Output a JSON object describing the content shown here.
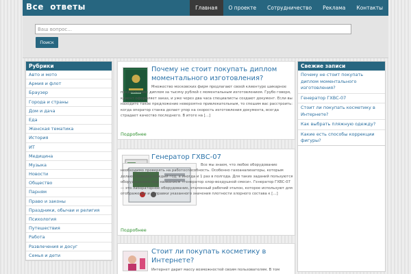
{
  "site": {
    "logo_text": "Все  ответы"
  },
  "nav": {
    "items": [
      "Главная",
      "О проекте",
      "Сотрудничество",
      "Реклама",
      "Контакты"
    ]
  },
  "search": {
    "placeholder": "Ваш вопрос...",
    "button_label": "Поиск"
  },
  "left_sidebar": {
    "title": "Рубрики",
    "items": [
      "Авто и мото",
      "Армия и флот",
      "Браузер",
      "Города и страны",
      "Дом и дача",
      "Еда",
      "Женская тематика",
      "История",
      "ИТ",
      "Медицина",
      "Музыка",
      "Новости",
      "Общество",
      "Парням",
      "Право и законы",
      "Праздники, обычаи и религия",
      "Психология",
      "Путешествия",
      "Работа",
      "Развлечения и досуг",
      "Семья и дети"
    ]
  },
  "posts": [
    {
      "title": "Почему не стоит покупать диплом моментального изготовления?",
      "excerpt": "Множество московских фирм предлагают своей клиентуре шикарное предложение: диплом за тысячу рублей с моментальным изготовлением. Грубо говоря, клиент оформляет заказ, и уже через два часа специалисты создают документ. Если вы находите такое предложение невероятно привлекательным, то спешим вас расстроить: когда оператор станка делает упор на скорость изготовления документа, всегда страдает качество последнего. В итоге на […]",
      "more": "Подробнее",
      "thumb": "diploma-image"
    },
    {
      "title": "Генератор ГХВС-07",
      "excerpt": "Все мы знаем, что любое оборудование необходимо проверять на работоспособность. Особенно газоанализаторы, которым делают поверку каждый год, а иногда и 1 раз в полгода. Для таких заданий пользуются оборудованием под названием «генератор хлор-воздушной смеси». Генератор ГХВС-07 — это лабораторное оборудование, эталонный рабочий эталон, которое используют для отображения и отправки указанного значения плотности хлорного состава к […]",
      "more": "Подробнее",
      "thumb": "device-image"
    },
    {
      "title": "Стоит ли покупать косметику в Интернете?",
      "excerpt": "Интернет дарит массу возможностей своим пользователям. В том",
      "thumb": "cosmetics-image"
    }
  ],
  "right_sidebar": {
    "title": "Свежие записи",
    "items": [
      "Почему не стоит покупать диплом моментального изготовления?",
      "Генератор ГХВС-07",
      "Стоит ли покупать косметику в Интернете?",
      "Как выбрать пляжную одежду?",
      "Какие есть способы коррекции фигуры?"
    ]
  },
  "colors": {
    "brand": "#276680",
    "link": "#2a72a8",
    "more_link": "#2d8f2d",
    "active_nav": "#3a3a3a"
  }
}
